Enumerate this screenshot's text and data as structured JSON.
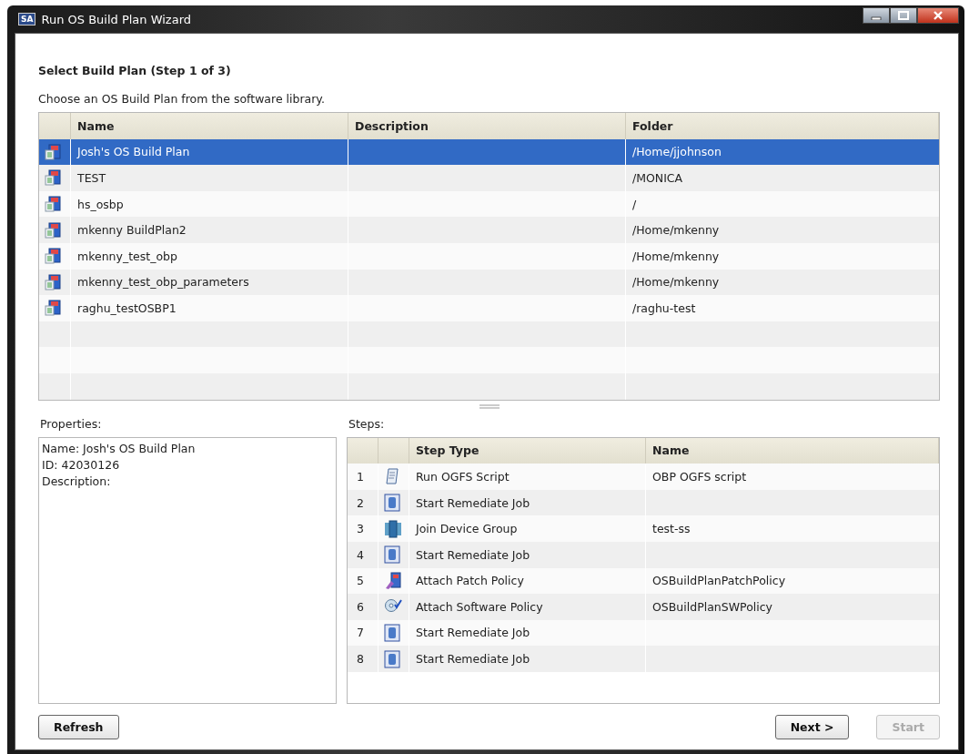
{
  "window": {
    "title": "Run OS Build Plan Wizard",
    "app_badge": "SA"
  },
  "heading": "Select Build Plan (Step 1 of 3)",
  "instruction": "Choose an OS Build Plan from the software library.",
  "plans": {
    "columns": [
      "Name",
      "Description",
      "Folder"
    ],
    "rows": [
      {
        "name": "Josh's OS Build Plan",
        "folder": "/Home/jjohnson",
        "selected": true
      },
      {
        "name": "TEST",
        "folder": "/MONICA",
        "selected": false
      },
      {
        "name": "hs_osbp",
        "folder": "/",
        "selected": false
      },
      {
        "name": "mkenny BuildPlan2",
        "folder": "/Home/mkenny",
        "selected": false
      },
      {
        "name": "mkenny_test_obp",
        "folder": "/Home/mkenny",
        "selected": false
      },
      {
        "name": "mkenny_test_obp_parameters",
        "folder": "/Home/mkenny",
        "selected": false
      },
      {
        "name": "raghu_testOSBP1",
        "folder": "/raghu-test",
        "selected": false
      }
    ]
  },
  "properties": {
    "label": "Properties:",
    "lines": [
      "Name: Josh's OS Build Plan",
      "ID: 42030126",
      "Description:"
    ]
  },
  "steps": {
    "label": "Steps:",
    "columns": [
      "Step Type",
      "Name"
    ],
    "rows": [
      {
        "number": "1",
        "kind": "script",
        "type": "Run OGFS Script",
        "name": "OBP OGFS script"
      },
      {
        "number": "2",
        "kind": "remediate",
        "type": "Start Remediate Job"
      },
      {
        "number": "3",
        "kind": "group",
        "type": "Join Device Group",
        "name": "test-ss"
      },
      {
        "number": "4",
        "kind": "remediate",
        "type": "Start Remediate Job"
      },
      {
        "number": "5",
        "kind": "patch",
        "type": "Attach Patch Policy",
        "name": "OSBuildPlanPatchPolicy"
      },
      {
        "number": "6",
        "kind": "software",
        "type": "Attach Software Policy",
        "name": "OSBuildPlanSWPolicy"
      },
      {
        "number": "7",
        "kind": "remediate",
        "type": "Start Remediate Job"
      },
      {
        "number": "8",
        "kind": "remediate",
        "type": "Start Remediate Job"
      }
    ]
  },
  "buttons": {
    "left": [
      {
        "label": "Refresh",
        "disabled": false
      }
    ],
    "right": [
      {
        "label": "Next >",
        "disabled": false
      },
      {
        "label": "Start",
        "disabled": true
      }
    ]
  }
}
